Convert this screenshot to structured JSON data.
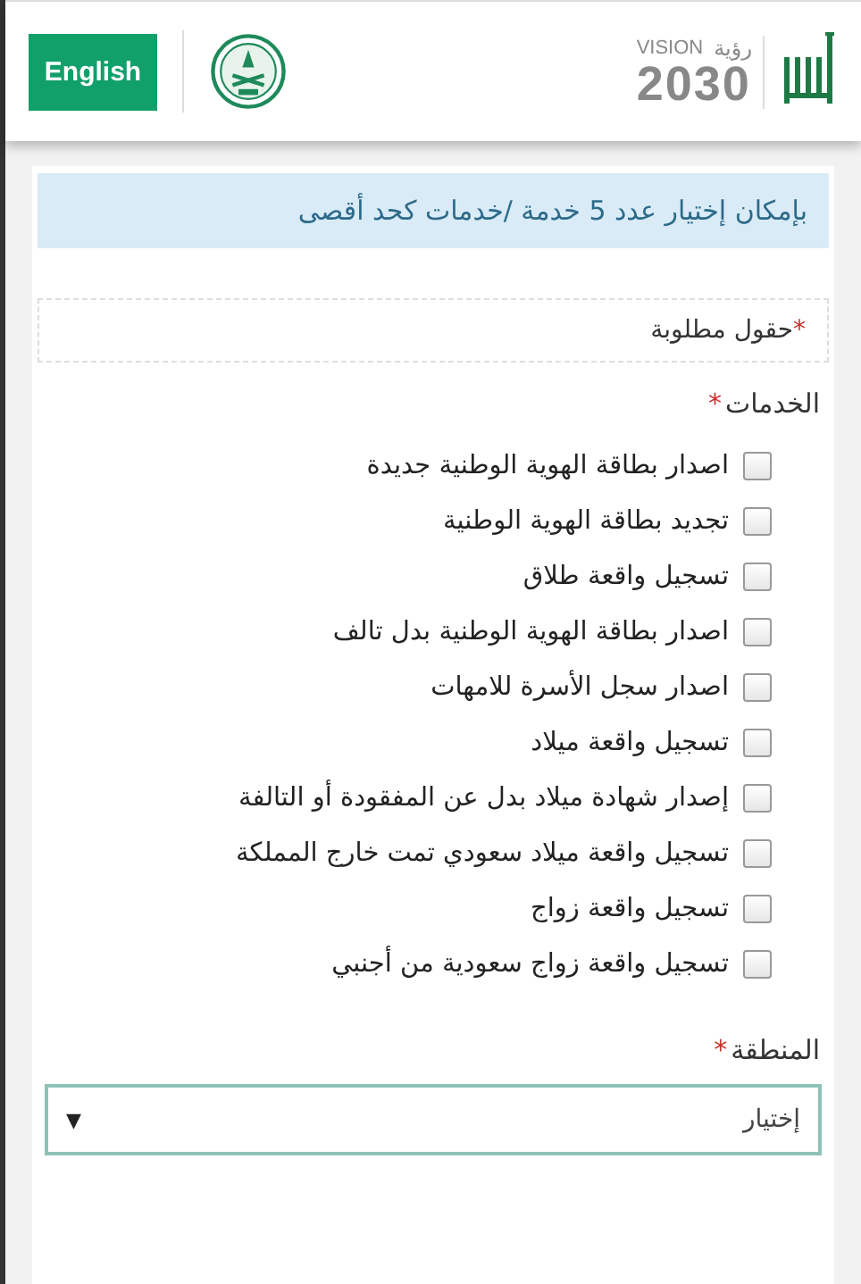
{
  "header": {
    "language_button": "English",
    "vision_logo": {
      "word": "VISION",
      "arabic": "رؤية",
      "year": "2030"
    }
  },
  "notice": "بإمكان إختيار عدد 5 خدمة /خدمات كحد أقصى",
  "required_note": {
    "asterisk": "*",
    "text": "حقول مطلوبة"
  },
  "services": {
    "label": "الخدمات",
    "asterisk": "*",
    "options": [
      {
        "label": "اصدار بطاقة الهوية الوطنية جديدة",
        "checked": false
      },
      {
        "label": "تجديد بطاقة الهوية الوطنية",
        "checked": false
      },
      {
        "label": "تسجيل واقعة طلاق",
        "checked": false
      },
      {
        "label": "اصدار بطاقة الهوية الوطنية بدل تالف",
        "checked": false
      },
      {
        "label": "اصدار سجل الأسرة للامهات",
        "checked": false
      },
      {
        "label": "تسجيل واقعة ميلاد",
        "checked": false
      },
      {
        "label": "إصدار شهادة ميلاد بدل عن المفقودة أو التالفة",
        "checked": false
      },
      {
        "label": "تسجيل واقعة ميلاد سعودي تمت خارج المملكة",
        "checked": false
      },
      {
        "label": "تسجيل واقعة زواج",
        "checked": false
      },
      {
        "label": "تسجيل واقعة زواج سعودية من أجنبي",
        "checked": false
      }
    ]
  },
  "region": {
    "label": "المنطقة",
    "asterisk": "*",
    "select": {
      "value": "إختيار",
      "arrow": "▼"
    }
  }
}
